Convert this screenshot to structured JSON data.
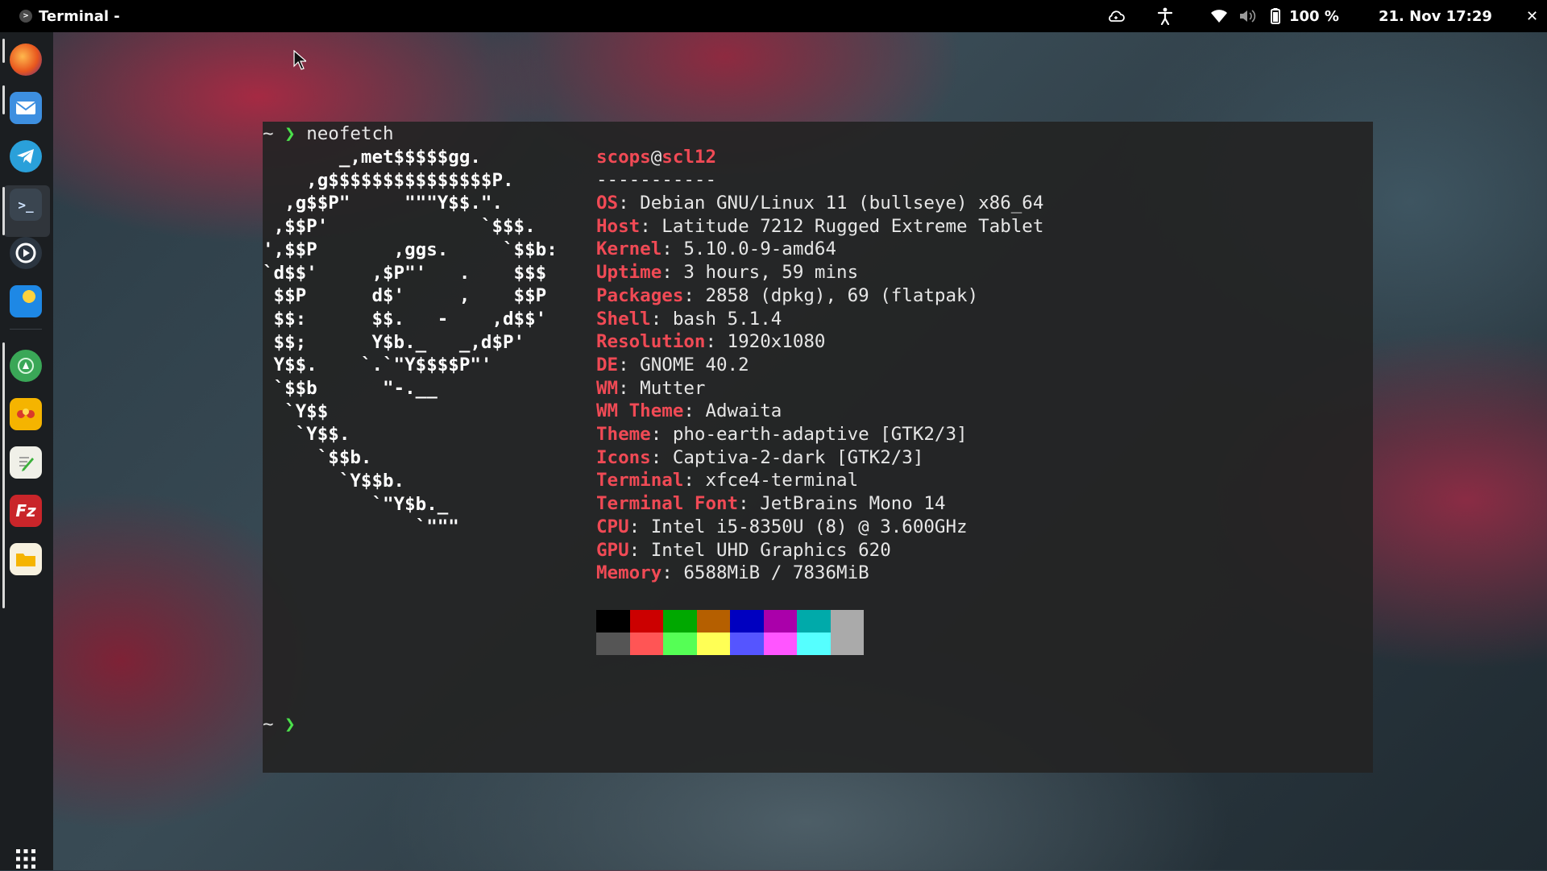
{
  "topbar": {
    "app_name": "Terminal -",
    "battery": "100 %",
    "datetime": "21. Nov 17:29",
    "close": "✕"
  },
  "dock": {
    "items": [
      "firefox-icon",
      "mail-icon",
      "telegram-icon",
      "terminal-icon",
      "media-icon",
      "weather-icon",
      "maps-icon",
      "stickers-icon",
      "notes-icon",
      "filezilla-icon",
      "files-icon"
    ],
    "apps_grid": "⋮⋮⋮"
  },
  "terminal": {
    "prompt_symbol": "❯",
    "home": "~",
    "command": "neofetch",
    "ascii_lines": [
      "       _,met$$$$$gg.",
      "    ,g$$$$$$$$$$$$$$$P.",
      "  ,g$$P\"     \"\"\"Y$$.\".",
      " ,$$P'              `$$$.",
      "',$$P       ,ggs.     `$$b:",
      "`d$$'     ,$P\"'   .    $$$",
      " $$P      d$'     ,    $$P",
      " $$:      $$.   -    ,d$$'",
      " $$;      Y$b._   _,d$P'",
      " Y$$.    `.`\"Y$$$$P\"'",
      " `$$b      \"-.__",
      "  `Y$$",
      "   `Y$$.",
      "     `$$b.",
      "       `Y$$b.",
      "          `\"Y$b._",
      "              `\"\"\""
    ],
    "user": "scops",
    "at": "@",
    "host": "scl12",
    "separator": "-----------",
    "info": [
      {
        "key": "OS",
        "value": ": Debian GNU/Linux 11 (bullseye) x86_64"
      },
      {
        "key": "Host",
        "value": ": Latitude 7212 Rugged Extreme Tablet"
      },
      {
        "key": "Kernel",
        "value": ": 5.10.0-9-amd64"
      },
      {
        "key": "Uptime",
        "value": ": 3 hours, 59 mins"
      },
      {
        "key": "Packages",
        "value": ": 2858 (dpkg), 69 (flatpak)"
      },
      {
        "key": "Shell",
        "value": ": bash 5.1.4"
      },
      {
        "key": "Resolution",
        "value": ": 1920x1080"
      },
      {
        "key": "DE",
        "value": ": GNOME 40.2"
      },
      {
        "key": "WM",
        "value": ": Mutter"
      },
      {
        "key": "WM Theme",
        "value": ": Adwaita"
      },
      {
        "key": "Theme",
        "value": ": pho-earth-adaptive [GTK2/3]"
      },
      {
        "key": "Icons",
        "value": ": Captiva-2-dark [GTK2/3]"
      },
      {
        "key": "Terminal",
        "value": ": xfce4-terminal"
      },
      {
        "key": "Terminal Font",
        "value": ": JetBrains Mono 14"
      },
      {
        "key": "CPU",
        "value": ": Intel i5-8350U (8) @ 3.600GHz"
      },
      {
        "key": "GPU",
        "value": ": Intel UHD Graphics 620"
      },
      {
        "key": "Memory",
        "value": ": 6588MiB / 7836MiB"
      }
    ],
    "palette_top": [
      "#000000",
      "#cc0000",
      "#00a800",
      "#b55f00",
      "#0000c0",
      "#aa00aa",
      "#00aaaa",
      "#aaaaaa"
    ],
    "palette_bottom": [
      "#555555",
      "#ff5555",
      "#55ff55",
      "#ffff55",
      "#5555ff",
      "#ff55ff",
      "#55ffff",
      "#aaaaaa"
    ]
  }
}
